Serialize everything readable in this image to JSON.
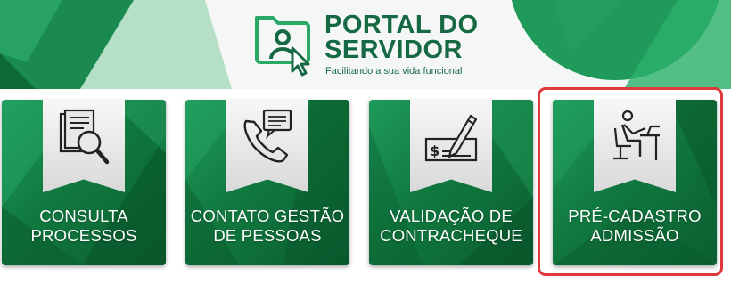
{
  "header": {
    "title_line1": "PORTAL DO",
    "title_line2": "SERVIDOR",
    "tagline": "Facilitando a sua vida funcional"
  },
  "tiles": [
    {
      "line1": "CONSULTA",
      "line2": "PROCESSOS",
      "icon": "document-search-icon"
    },
    {
      "line1": "CONTATO GESTÃO",
      "line2": "DE PESSOAS",
      "icon": "phone-message-icon"
    },
    {
      "line1": "VALIDAÇÃO DE",
      "line2": "CONTRACHEQUE",
      "icon": "check-sign-icon"
    },
    {
      "line1": "PRÉ-CADASTRO",
      "line2": "ADMISSÃO",
      "icon": "person-desk-icon"
    }
  ],
  "colors": {
    "brand_green": "#156a44",
    "tile_green": "#10793f",
    "highlight_red": "#e0393b"
  }
}
